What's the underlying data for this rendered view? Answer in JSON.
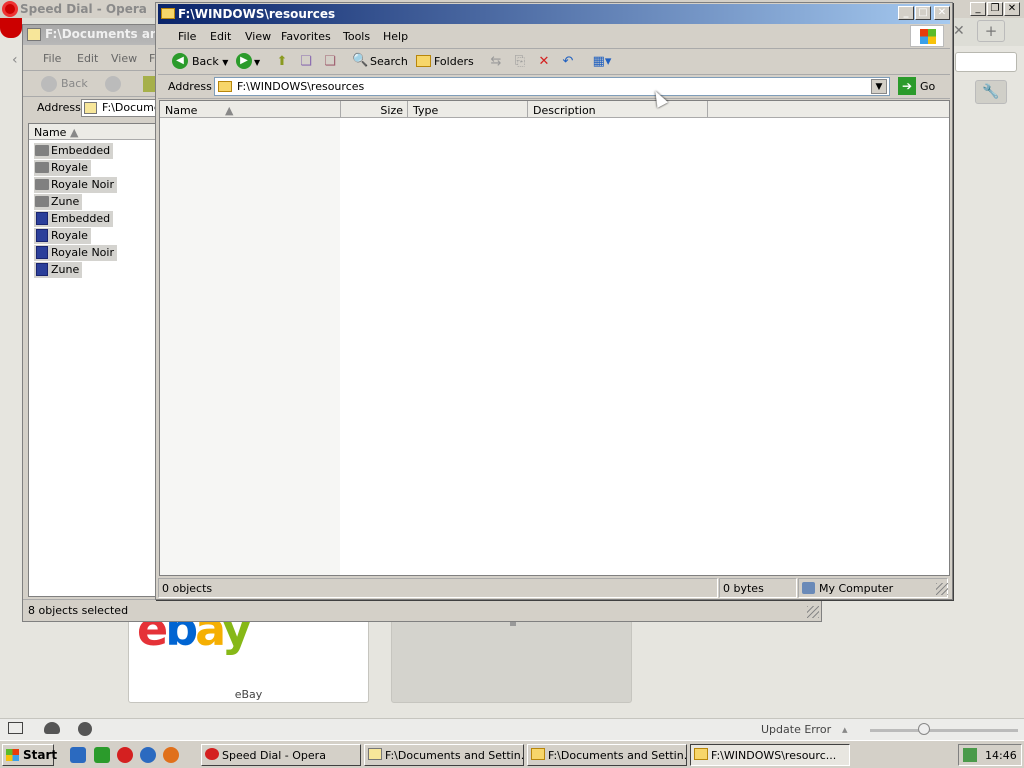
{
  "opera": {
    "title": "Speed Dial - Opera",
    "tile_ebay_label": "eBay",
    "status_update": "Update Error"
  },
  "back_window": {
    "title": "F:\\Documents and S",
    "menu": [
      "File",
      "Edit",
      "View",
      "F"
    ],
    "toolbar_back": "Back",
    "address_label": "Address",
    "address_value": "F:\\Docume",
    "column_name": "Name",
    "items": [
      {
        "label": "Embedded",
        "icon": "folder-icon"
      },
      {
        "label": "Royale",
        "icon": "folder-icon"
      },
      {
        "label": "Royale Noir",
        "icon": "folder-icon"
      },
      {
        "label": "Zune",
        "icon": "folder-icon"
      },
      {
        "label": "Embedded",
        "icon": "theme-file-icon"
      },
      {
        "label": "Royale",
        "icon": "theme-file-icon"
      },
      {
        "label": "Royale Noir",
        "icon": "theme-file-icon"
      },
      {
        "label": "Zune",
        "icon": "theme-file-icon"
      }
    ],
    "status": "8 objects selected"
  },
  "front_window": {
    "title": "F:\\WINDOWS\\resources",
    "menu": [
      "File",
      "Edit",
      "View",
      "Favorites",
      "Tools",
      "Help"
    ],
    "toolbar": {
      "back": "Back",
      "search": "Search",
      "folders": "Folders"
    },
    "address_label": "Address",
    "address_value": "F:\\WINDOWS\\resources",
    "go_label": "Go",
    "columns": [
      "Name",
      "Size",
      "Type",
      "Description"
    ],
    "status": {
      "objects": "0 objects",
      "bytes": "0 bytes",
      "location": "My Computer"
    }
  },
  "taskbar": {
    "start": "Start",
    "tasks": [
      {
        "label": "Speed Dial - Opera",
        "icon": "opera-icon",
        "active": false
      },
      {
        "label": "F:\\Documents and Settin...",
        "icon": "folder-icon",
        "active": false
      },
      {
        "label": "F:\\Documents and Settin...",
        "icon": "folder-icon",
        "active": false
      },
      {
        "label": "F:\\WINDOWS\\resourc...",
        "icon": "folder-icon",
        "active": true
      }
    ],
    "clock": "14:46"
  },
  "colors": {
    "title_active": "#0a246a",
    "face": "#d4d0c8",
    "selection": "#d4d3cf"
  }
}
